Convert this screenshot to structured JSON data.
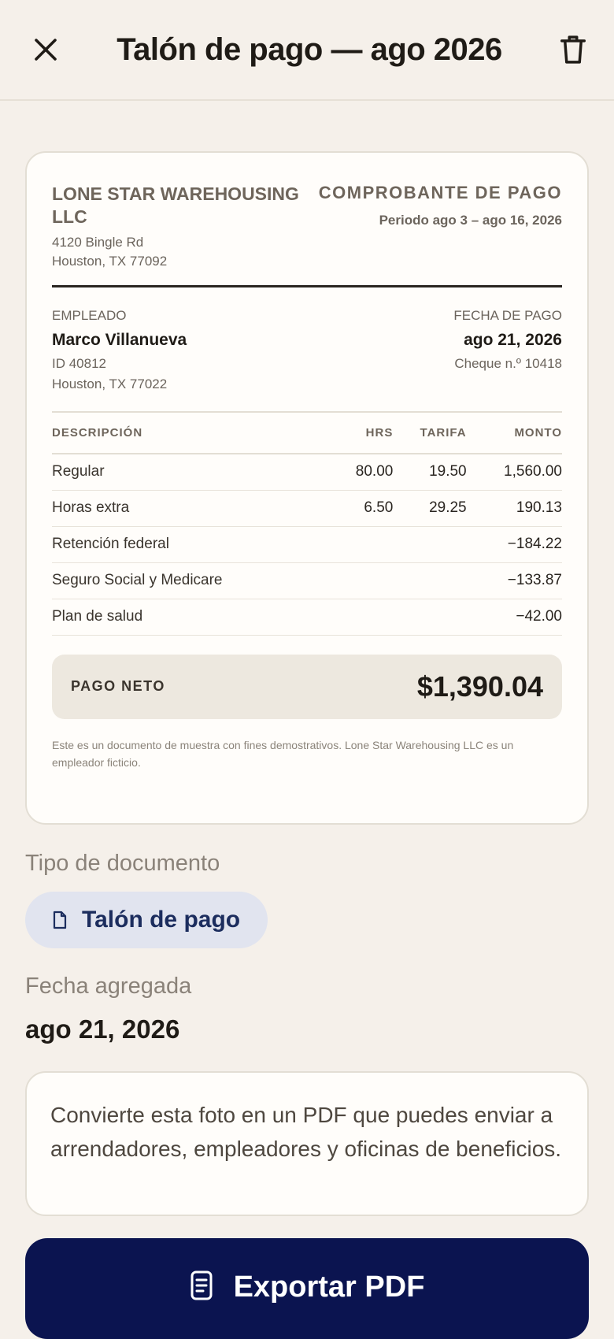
{
  "header": {
    "title": "Talón de pago — ago 2026",
    "close_icon": "close-icon",
    "delete_icon": "trash-icon"
  },
  "stub": {
    "company": {
      "name": "LONE STAR WAREHOUSING LLC",
      "address_line1": "4120 Bingle Rd",
      "address_line2": "Houston, TX 77092"
    },
    "doc_kind": "COMPROBANTE DE PAGO",
    "period": "Periodo ago 3 – ago 16, 2026",
    "employee": {
      "label": "EMPLEADO",
      "name": "Marco Villanueva",
      "id": "ID 40812",
      "city": "Houston, TX 77022"
    },
    "payment": {
      "label": "FECHA DE PAGO",
      "date": "ago 21, 2026",
      "check": "Cheque n.º 10418"
    },
    "table": {
      "headers": [
        "DESCRIPCIÓN",
        "HRS",
        "TARIFA",
        "MONTO"
      ],
      "rows": [
        [
          "Regular",
          "80.00",
          "19.50",
          "1,560.00"
        ],
        [
          "Horas extra",
          "6.50",
          "29.25",
          "190.13"
        ],
        [
          "Retención federal",
          "",
          "",
          "−184.22"
        ],
        [
          "Seguro Social y Medicare",
          "",
          "",
          "−133.87"
        ],
        [
          "Plan de salud",
          "",
          "",
          "−42.00"
        ]
      ]
    },
    "net_pay": {
      "label": "PAGO NETO",
      "value": "$1,390.04"
    },
    "disclaimer": "Este es un documento de muestra con fines demostrativos. Lone Star Warehousing LLC es un empleador ficticio."
  },
  "doc_type": {
    "label": "Tipo de documento",
    "chip": "Talón de pago",
    "icon": "document-icon"
  },
  "date_added": {
    "label": "Fecha agregada",
    "value": "ago 21, 2026"
  },
  "info_text": "Convierte esta foto en un PDF que puedes enviar a arrendadores, empleadores y oficinas de beneficios.",
  "export": {
    "label": "Exportar PDF",
    "icon": "pdf-document-icon"
  },
  "colors": {
    "background": "#f5f0ea",
    "primary": "#0b1450",
    "chip": "#e1e4ef"
  }
}
